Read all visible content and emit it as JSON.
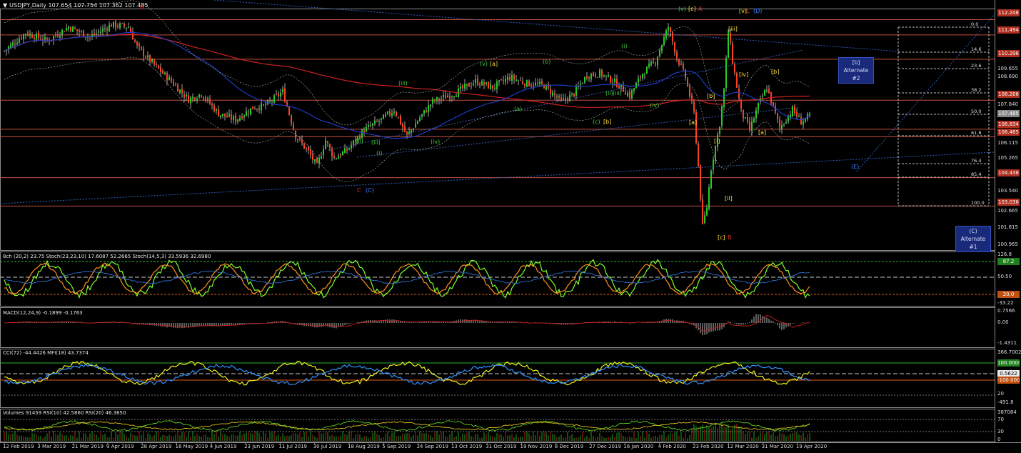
{
  "header": {
    "main": "USDJPY,Daily  107.654 107.754 107.362 107.485",
    "stoch": "8ch (20,2) 23.75  Stoch(23,23,10) 17.6087 52.2665  Stoch(14,5,3) 33.5936 32.6980",
    "macd": "MACD(12,24,9) -0.1899 -0.1763",
    "cci": "CCI(72) -44.4426  MFI(18) 43.7374",
    "vol": "Volumes 91459  RSI(10) 42.5860  RSI(20) 46.3650"
  },
  "price_axis": [
    "112.248",
    "111.494",
    "110.296",
    "109.655",
    "108.690",
    "108.266",
    "107.840",
    "107.485",
    "106.834",
    "106.465",
    "106.115",
    "105.265",
    "104.438",
    "103.540",
    "103.036",
    "102.665",
    "101.815",
    "100.965"
  ],
  "price_tags": [
    {
      "label": "112.248",
      "color": "#b03020"
    },
    {
      "label": "111.494",
      "color": "#b03020"
    },
    {
      "label": "110.296",
      "color": "#b03020"
    },
    {
      "label": "108.266",
      "color": "#b03020"
    },
    {
      "label": "107.485",
      "color": "#888888"
    },
    {
      "label": "106.834",
      "color": "#b03020"
    },
    {
      "label": "106.465",
      "color": "#b03020"
    },
    {
      "label": "104.438",
      "color": "#b03020"
    },
    {
      "label": "103.036",
      "color": "#b03020"
    }
  ],
  "fib_levels": [
    "0.0",
    "14.6",
    "23.6",
    "38.2",
    "50.0",
    "61.8",
    "76.4",
    "85.4",
    "100.0"
  ],
  "wave_labels": [
    {
      "t": "B",
      "c": "#e03030"
    },
    {
      "t": "C",
      "c": "#e03030"
    },
    {
      "t": "(C)",
      "c": "#4080ff"
    },
    {
      "t": "(v)",
      "c": "#40d040"
    },
    {
      "t": "[c]",
      "c": "#ffe040"
    },
    {
      "t": "A",
      "c": "#e03030"
    },
    {
      "t": "[v]",
      "c": "#ffe040"
    },
    {
      "t": "C",
      "c": "#e03030"
    },
    {
      "t": "(D)",
      "c": "#4080ff"
    },
    {
      "t": "[iii]",
      "c": "#ffe040"
    },
    {
      "t": "[b]",
      "c": "#ffe040"
    },
    {
      "t": "[iv]",
      "c": "#ffe040"
    },
    {
      "t": "[a]",
      "c": "#ffe040"
    },
    {
      "t": "[i]",
      "c": "#ffe040"
    },
    {
      "t": "[ii]",
      "c": "#ffe040"
    },
    {
      "t": "[c]",
      "c": "#ffe040"
    },
    {
      "t": "B",
      "c": "#e03030"
    },
    {
      "t": "(E)",
      "c": "#4080ff"
    },
    {
      "t": "(c)",
      "c": "#40d040"
    },
    {
      "t": "[b]",
      "c": "#ffe040"
    },
    {
      "t": "[a]",
      "c": "#ffe040"
    },
    {
      "t": "[b]",
      "c": "#ffe040"
    },
    {
      "t": "(iii)",
      "c": "#40d040"
    },
    {
      "t": "(iv)",
      "c": "#40d040"
    },
    {
      "t": "(ii)",
      "c": "#40d040"
    },
    {
      "t": "(i)",
      "c": "#40d040"
    },
    {
      "t": "(iii)",
      "c": "#40d040"
    },
    {
      "t": "(v)",
      "c": "#40d040"
    },
    {
      "t": "[a]",
      "c": "#ffe040"
    },
    {
      "t": "(b)",
      "c": "#40d040"
    },
    {
      "t": "(a)",
      "c": "#40d040"
    },
    {
      "t": "(iii)",
      "c": "#40d040"
    },
    {
      "t": "(iv)",
      "c": "#40d040"
    },
    {
      "t": "(ii)",
      "c": "#40d040"
    },
    {
      "t": "(i)",
      "c": "#40d040"
    }
  ],
  "boxes": [
    {
      "l1": "[b]",
      "l2": "Alternate #2"
    },
    {
      "l1": "(C)",
      "l2": "Alternate #1"
    }
  ],
  "stoch_axis": [
    "126.8",
    "50.50",
    "20",
    "-33.22"
  ],
  "stoch_tags": [
    {
      "label": "87.2",
      "color": "#208020"
    },
    {
      "label": "20.0",
      "color": "#c05010"
    }
  ],
  "macd_axis": [
    "0.7566",
    "0.00",
    "-1.4311"
  ],
  "cci_axis": [
    "366.7002",
    "0.5622",
    "20",
    "-491.8"
  ],
  "cci_tags": [
    {
      "label": "100.0000",
      "color": "#208020"
    },
    {
      "label": "0.5622",
      "color": "#333333"
    },
    {
      "label": "-100.0000",
      "color": "#c05010"
    }
  ],
  "vol_axis": [
    "387084",
    "70",
    "30",
    "0"
  ],
  "dates": [
    "12 Feb 2019",
    "3 Mar 2019",
    "21 Mar 2019",
    "9 Apr 2019",
    "28 Apr 2019",
    "16 May 2019",
    "4 Jun 2019",
    "23 Jun 2019",
    "11 Jul 2019",
    "30 Jul 2019",
    "18 Aug 2019",
    "5 Sep 2019",
    "24 Sep 2019",
    "13 Oct 2019",
    "31 Oct 2019",
    "19 Nov 2019",
    "8 Dec 2019",
    "27 Dec 2019",
    "16 Jan 2020",
    "4 Feb 2020",
    "23 Feb 2020",
    "12 Mar 2020",
    "31 Mar 2020",
    "19 Apr 2020"
  ],
  "chart_data": {
    "type": "candlestick",
    "symbol": "USDJPY",
    "timeframe": "Daily",
    "last": {
      "open": 107.654,
      "high": 107.754,
      "low": 107.362,
      "close": 107.485
    },
    "ylim": [
      100.965,
      112.6
    ],
    "horizontal_levels": [
      112.248,
      111.494,
      110.296,
      108.266,
      106.834,
      106.465,
      104.438,
      103.036
    ],
    "price_path": [
      [
        0,
        110.7
      ],
      [
        10,
        111.6
      ],
      [
        20,
        111.2
      ],
      [
        30,
        111.9
      ],
      [
        40,
        111.4
      ],
      [
        50,
        112.0
      ],
      [
        58,
        111.9
      ],
      [
        62,
        110.9
      ],
      [
        70,
        110.0
      ],
      [
        78,
        109.2
      ],
      [
        86,
        108.3
      ],
      [
        92,
        108.6
      ],
      [
        100,
        107.6
      ],
      [
        108,
        107.3
      ],
      [
        116,
        107.9
      ],
      [
        122,
        108.0
      ],
      [
        130,
        108.7
      ],
      [
        136,
        106.5
      ],
      [
        142,
        105.7
      ],
      [
        146,
        105.0
      ],
      [
        150,
        106.3
      ],
      [
        154,
        105.4
      ],
      [
        160,
        105.8
      ],
      [
        168,
        106.8
      ],
      [
        176,
        107.3
      ],
      [
        182,
        107.8
      ],
      [
        188,
        106.5
      ],
      [
        194,
        107.4
      ],
      [
        200,
        108.2
      ],
      [
        210,
        108.6
      ],
      [
        220,
        109.2
      ],
      [
        228,
        108.9
      ],
      [
        236,
        109.4
      ],
      [
        244,
        109.1
      ],
      [
        252,
        109.0
      ],
      [
        260,
        108.2
      ],
      [
        266,
        108.6
      ],
      [
        272,
        109.5
      ],
      [
        278,
        109.6
      ],
      [
        286,
        109.1
      ],
      [
        292,
        108.5
      ],
      [
        298,
        109.6
      ],
      [
        304,
        110.2
      ],
      [
        310,
        111.9
      ],
      [
        314,
        110.4
      ],
      [
        318,
        109.4
      ],
      [
        322,
        107.6
      ],
      [
        324,
        105.0
      ],
      [
        326,
        102.0
      ],
      [
        328,
        103.0
      ],
      [
        330,
        104.9
      ],
      [
        334,
        107.1
      ],
      [
        336,
        108.8
      ],
      [
        338,
        111.7
      ],
      [
        340,
        110.2
      ],
      [
        344,
        107.7
      ],
      [
        348,
        106.8
      ],
      [
        352,
        108.0
      ],
      [
        356,
        108.9
      ],
      [
        362,
        106.9
      ],
      [
        368,
        107.8
      ],
      [
        372,
        107.2
      ],
      [
        376,
        107.485
      ]
    ],
    "fibonacci": {
      "levels": [
        0.0,
        14.6,
        23.6,
        38.2,
        50.0,
        61.8,
        76.4,
        85.4,
        100.0
      ]
    },
    "indicators": {
      "stochastic": {
        "ch": 23.75,
        "stoch_23_23_10": [
          17.6087,
          52.2665
        ],
        "stoch_14_5_3": [
          33.5936,
          32.698
        ]
      },
      "macd": {
        "params": [
          12,
          24,
          9
        ],
        "values": [
          -0.1899,
          -0.1763
        ]
      },
      "cci72": -44.4426,
      "mfi18": 43.7374,
      "volume": 91459,
      "rsi10": 42.586,
      "rsi20": 46.365
    }
  }
}
